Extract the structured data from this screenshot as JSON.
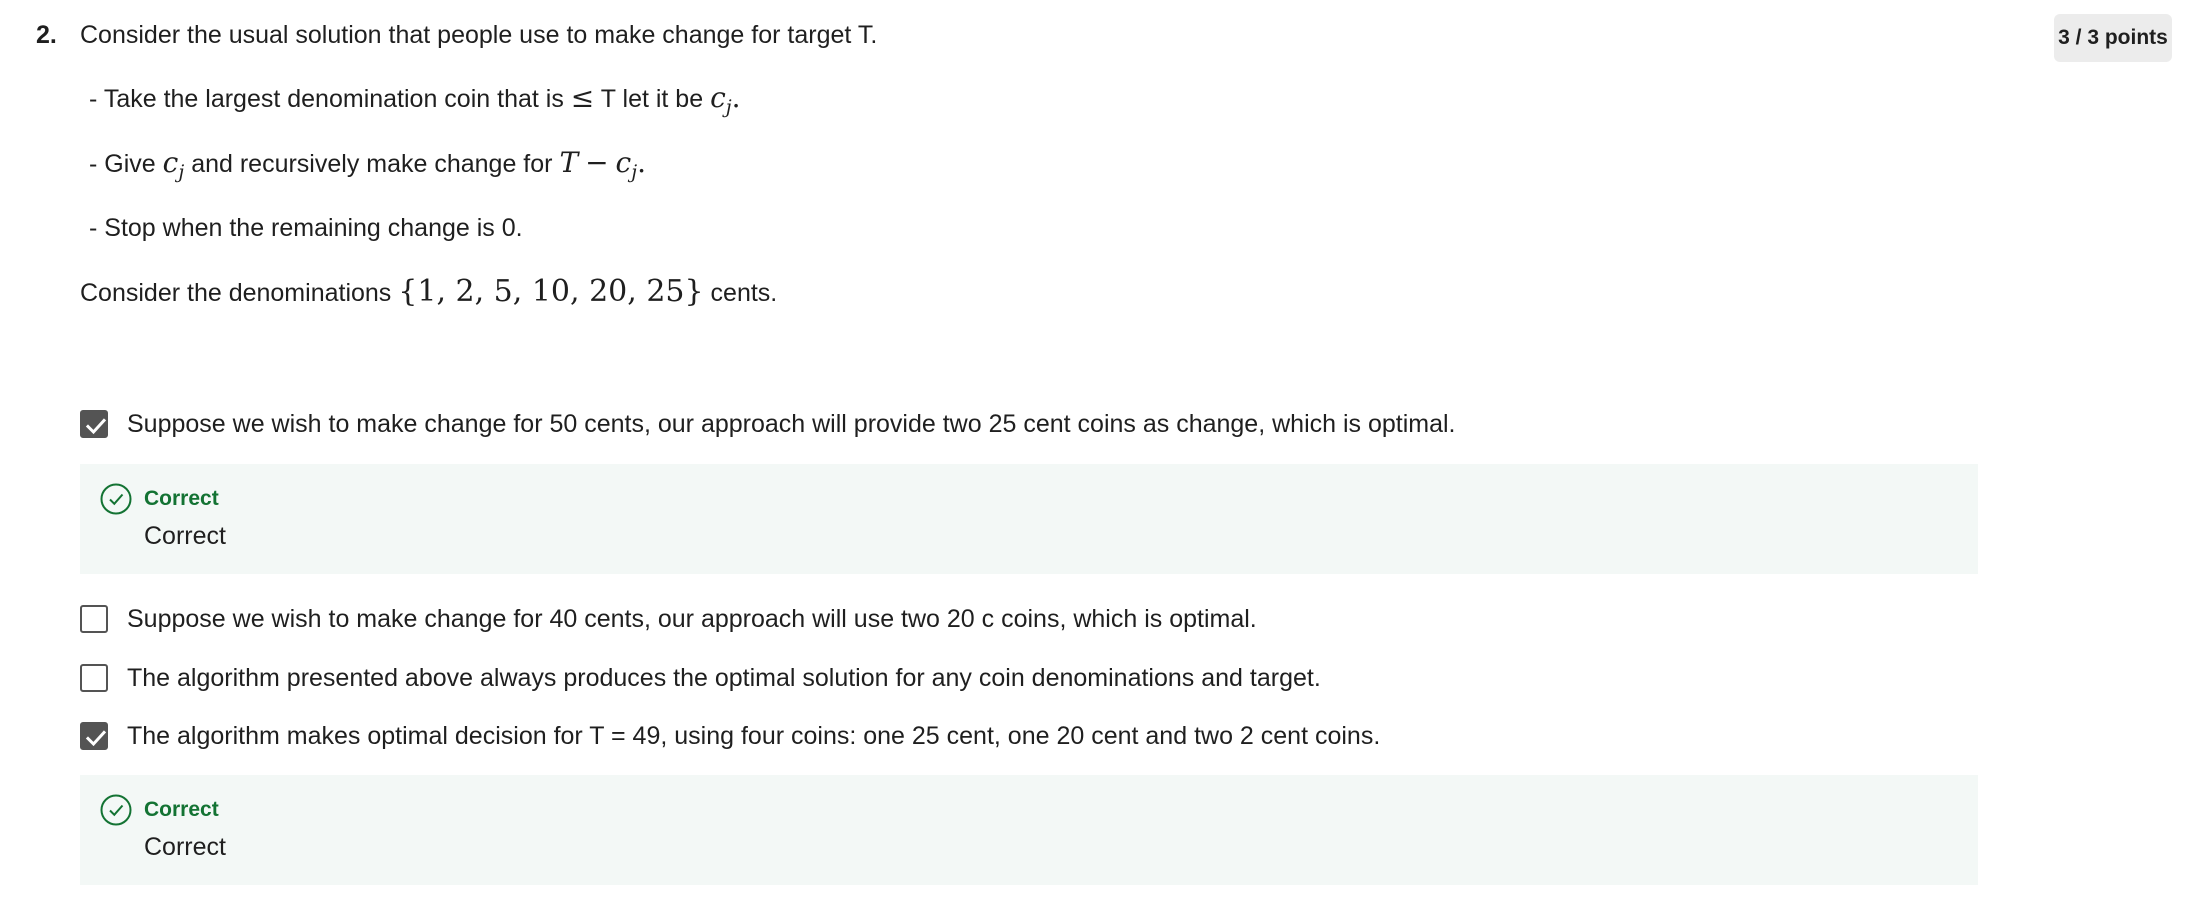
{
  "question": {
    "number": "2.",
    "text": "Consider the usual solution that people use to make change for target T.",
    "points": "3 / 3 points"
  },
  "steps": [
    {
      "prefix": "- Take the largest denomination coin that is",
      "leq": "≤",
      "middle": "T let it be",
      "var": "c",
      "sub": "j",
      "suffix": "."
    },
    {
      "prefix": "- Give",
      "var": "c",
      "sub": "j",
      "middle": "and recursively make change for",
      "T": "T",
      "minus": "−",
      "var2": "c",
      "sub2": "j",
      "suffix": "."
    },
    {
      "text": "- Stop when the remaining change is 0."
    }
  ],
  "denominations": {
    "prefix": "Consider the denominations",
    "set": "{1, 2, 5, 10, 20, 25}",
    "suffix": "cents."
  },
  "options": [
    {
      "label": "Suppose we wish to make change for 50 cents, our approach will provide two 25 cent coins as change, which is optimal.",
      "checked": true
    },
    {
      "label": "Suppose we wish to make change for 40 cents, our approach will use two 20 c coins, which is optimal.",
      "checked": false
    },
    {
      "label": "The algorithm presented above always produces the optimal solution for any coin denominations and target.",
      "checked": false
    },
    {
      "label": "The algorithm makes optimal decision for T = 49, using four coins: one 25 cent, one 20 cent and two 2 cent coins.",
      "checked": true
    }
  ],
  "feedback": [
    {
      "title": "Correct",
      "text": "Correct"
    },
    {
      "title": "Correct",
      "text": "Correct"
    }
  ],
  "colors": {
    "correct_green": "#137333",
    "feedback_bg": "#f3f8f6",
    "checkbox_fill": "#545454",
    "badge_bg": "#ececec"
  },
  "icons": {
    "checked_checkbox": "checkmark-icon",
    "feedback": "check-circle-icon"
  }
}
